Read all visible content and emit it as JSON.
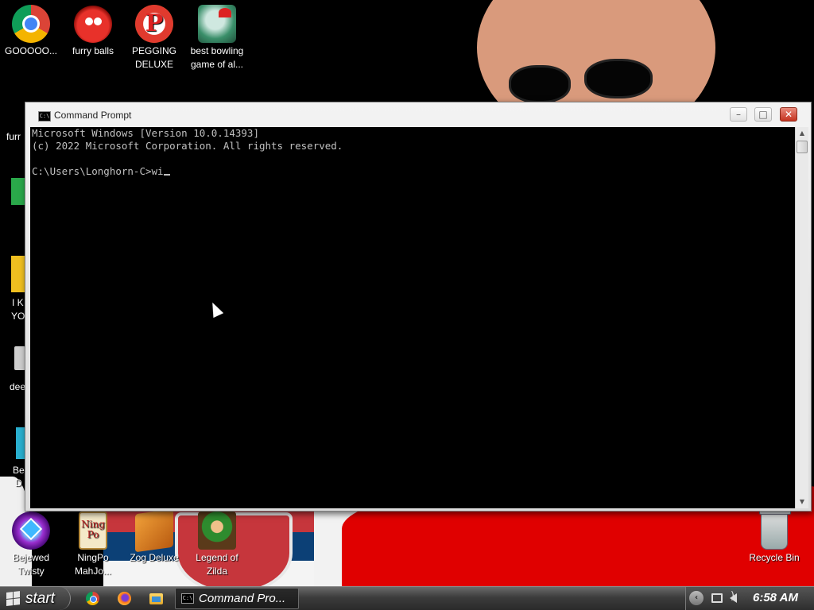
{
  "desktop_icons": [
    {
      "label": "GOOOOO...",
      "icon": "chrome-icon"
    },
    {
      "label": "furry balls",
      "icon": "furry-balls-icon"
    },
    {
      "label": "PEGGING DELUXE",
      "icon": "pegging-deluxe-icon"
    },
    {
      "label": "best bowling game of al...",
      "icon": "bowling-icon"
    },
    {
      "label": "Bejewed Twisty",
      "icon": "bejeweled-icon"
    },
    {
      "label": "NingPo MahJo...",
      "icon": "mahjong-icon"
    },
    {
      "label": "Zog Deluxe",
      "icon": "zog-icon"
    },
    {
      "label": "Legend of Zilda",
      "icon": "zelda-icon"
    },
    {
      "label": "Recycle Bin",
      "icon": "recycle-bin-icon"
    }
  ],
  "partial_icon_labels": [
    "furr",
    "I K",
    "YO",
    "dee",
    "Be",
    "D"
  ],
  "window": {
    "title": "Command Prompt",
    "icon_glyph": "C:\\",
    "minimize_glyph": "–",
    "maximize_glyph": "□",
    "close_glyph": "✕"
  },
  "console": {
    "lines": [
      "Microsoft Windows [Version 10.0.14393]",
      "(c) 2022 Microsoft Corporation. All rights reserved.",
      "",
      "C:\\Users\\Longhorn-C>wi"
    ],
    "text_color": "#c0c0c0",
    "background": "#000000"
  },
  "scrollbar": {
    "up_glyph": "▲",
    "down_glyph": "▼"
  },
  "taskbar": {
    "start_label": "start",
    "quick_launch": [
      "chrome-icon",
      "firefox-icon",
      "file-explorer-icon"
    ],
    "task_item": {
      "label": "Command Pro...",
      "icon_glyph": "C:\\"
    },
    "tray_chevron": "‹",
    "clock": "6:58 AM"
  }
}
